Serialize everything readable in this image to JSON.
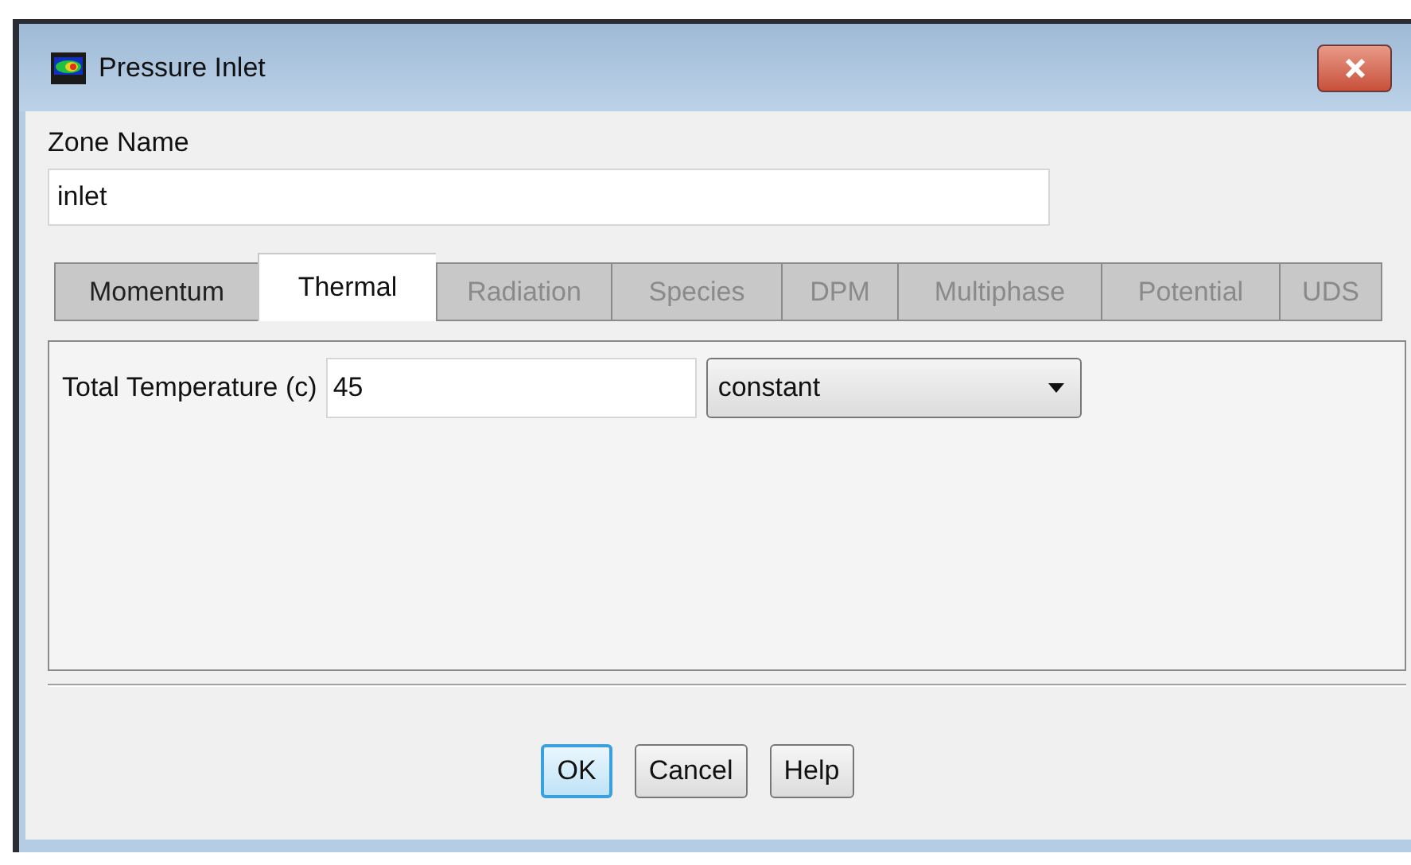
{
  "window": {
    "title": "Pressure Inlet"
  },
  "zone_name": {
    "label": "Zone Name",
    "value": "inlet"
  },
  "tabs": [
    {
      "label": "Momentum",
      "selected": false,
      "disabled": false
    },
    {
      "label": "Thermal",
      "selected": true,
      "disabled": false
    },
    {
      "label": "Radiation",
      "selected": false,
      "disabled": true
    },
    {
      "label": "Species",
      "selected": false,
      "disabled": true
    },
    {
      "label": "DPM",
      "selected": false,
      "disabled": true
    },
    {
      "label": "Multiphase",
      "selected": false,
      "disabled": true
    },
    {
      "label": "Potential",
      "selected": false,
      "disabled": true
    },
    {
      "label": "UDS",
      "selected": false,
      "disabled": true
    }
  ],
  "thermal": {
    "label": "Total Temperature (c)",
    "value": "45",
    "method": "constant"
  },
  "buttons": [
    {
      "label": "OK",
      "focused": true
    },
    {
      "label": "Cancel",
      "focused": false
    },
    {
      "label": "Help",
      "focused": false
    }
  ]
}
